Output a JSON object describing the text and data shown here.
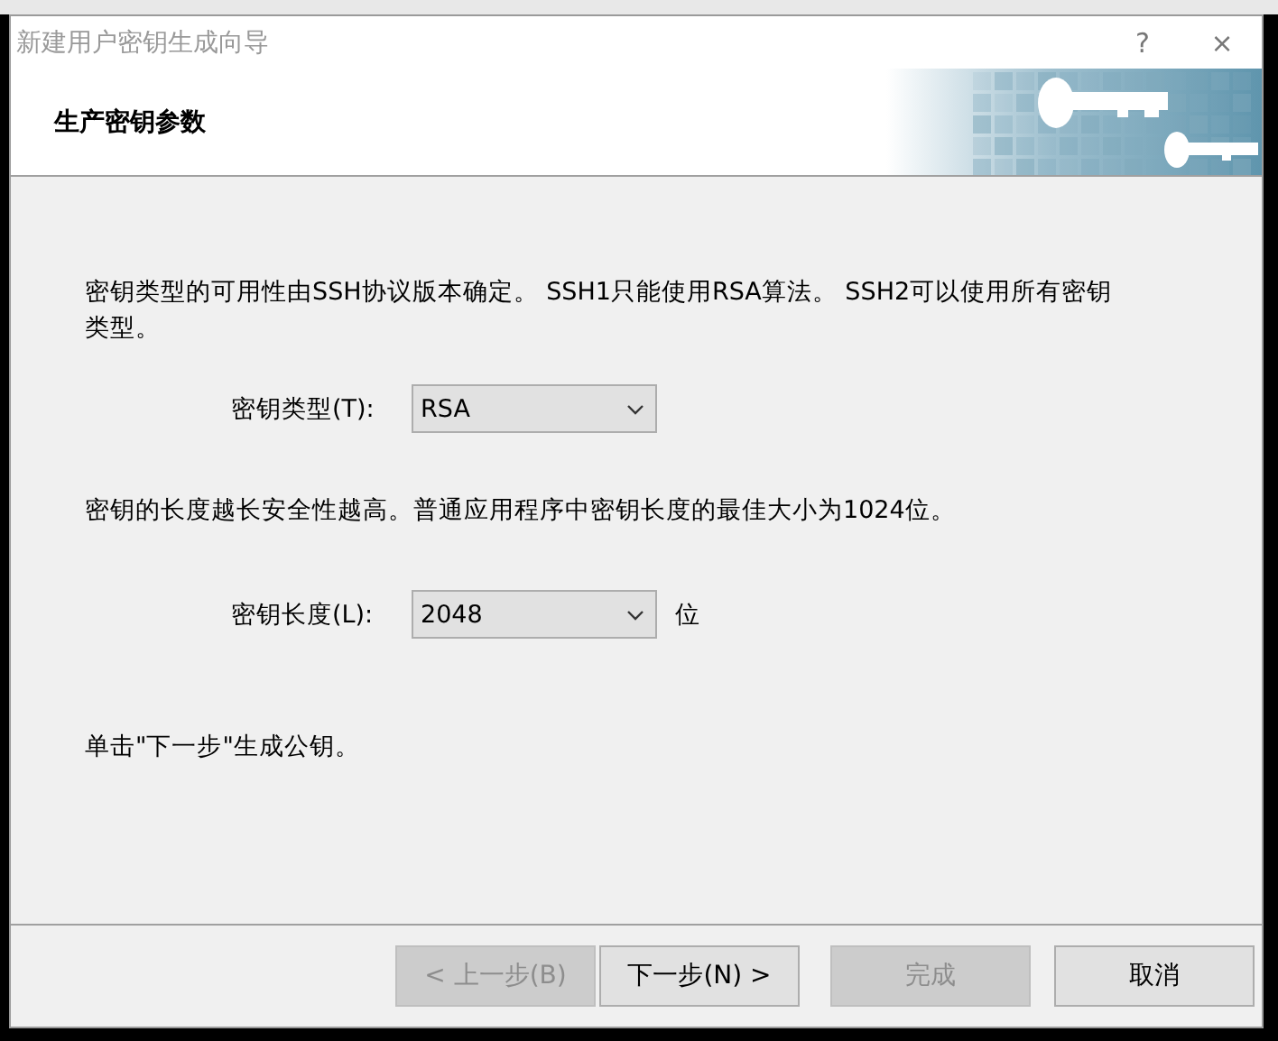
{
  "window": {
    "title": "新建用户密钥生成向导",
    "help": "?",
    "close": "×"
  },
  "header": {
    "title": "生产密钥参数"
  },
  "intro": "密钥类型的可用性由SSH协议版本确定。 SSH1只能使用RSA算法。 SSH2可以使用所有密钥类型。",
  "key_type": {
    "label": "密钥类型(T):",
    "value": "RSA"
  },
  "length_note": "密钥的长度越长安全性越高。普通应用程序中密钥长度的最佳大小为1024位。",
  "key_length": {
    "label": "密钥长度(L):",
    "value": "2048",
    "unit": "位"
  },
  "hint": "单击\"下一步\"生成公钥。",
  "buttons": [
    {
      "label": "< 上一步(B)",
      "disabled": true
    },
    {
      "label": "下一步(N) >",
      "disabled": false
    },
    {
      "label": "完成",
      "disabled": true
    },
    {
      "label": "取消",
      "disabled": false
    }
  ]
}
